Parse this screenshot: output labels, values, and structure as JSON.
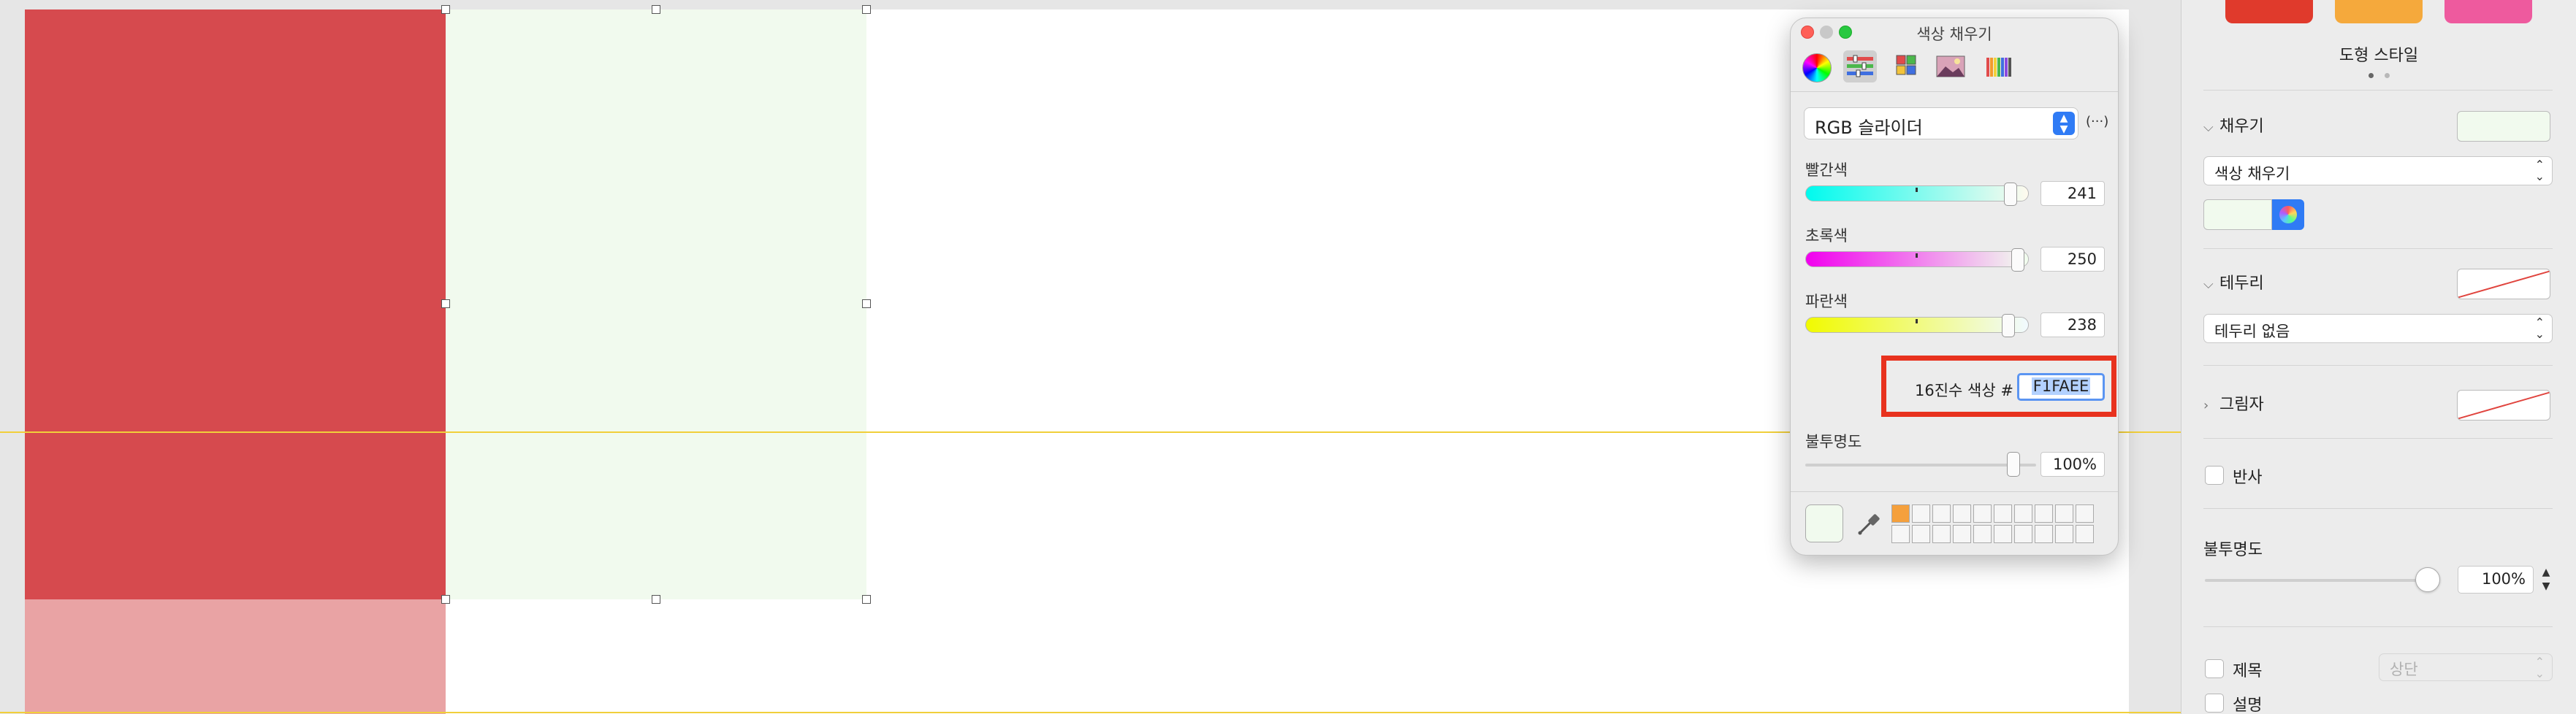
{
  "canvas": {
    "colors": {
      "red_shape": "#D64A4E",
      "pink_shape": "#E9A3A4",
      "green_shape": "#F1FAEE",
      "guide": "#F1CF3A"
    }
  },
  "color_panel": {
    "title": "색상 채우기",
    "mode_icons": [
      "color-wheel-icon",
      "color-sliders-icon",
      "color-palettes-icon",
      "image-palettes-icon",
      "pencils-icon"
    ],
    "mode_select": "RGB 슬라이더",
    "more_label": "(···)",
    "sliders": [
      {
        "label": "빨간색",
        "value": "241",
        "fraction": 0.945,
        "gradient": "linear-gradient(to right, #00FAEE, #FFFAEE)"
      },
      {
        "label": "초록색",
        "value": "250",
        "fraction": 0.98,
        "gradient": "linear-gradient(to right, #F100EE, #F1FFEE)"
      },
      {
        "label": "파란색",
        "value": "238",
        "fraction": 0.933,
        "gradient": "linear-gradient(to right, #F1FA00, #F1FAFF)"
      }
    ],
    "hex_label": "16진수 색상 #",
    "hex_value": "F1FAEE",
    "opacity_label": "불투명도",
    "opacity_value": "100%",
    "opacity_fraction": 1.0,
    "current_color": "#F1FAEE",
    "swatch_colors": [
      "#F5A03C"
    ]
  },
  "inspector": {
    "style_swatches": [
      "#E03A2C",
      "#F5A93C",
      "#EE5A9E"
    ],
    "tab_title": "도형 스타일",
    "fill": {
      "heading": "채우기",
      "color": "#F1FAEE",
      "type": "색상 채우기"
    },
    "border": {
      "heading": "테두리",
      "type": "테두리 없음"
    },
    "shadow": {
      "heading": "그림자"
    },
    "reflection": {
      "label": "반사"
    },
    "opacity": {
      "heading": "불투명도",
      "value": "100%",
      "fraction": 1.0
    },
    "title_checkbox": {
      "label": "제목",
      "position": "상단"
    },
    "caption_checkbox": {
      "label": "설명"
    }
  }
}
